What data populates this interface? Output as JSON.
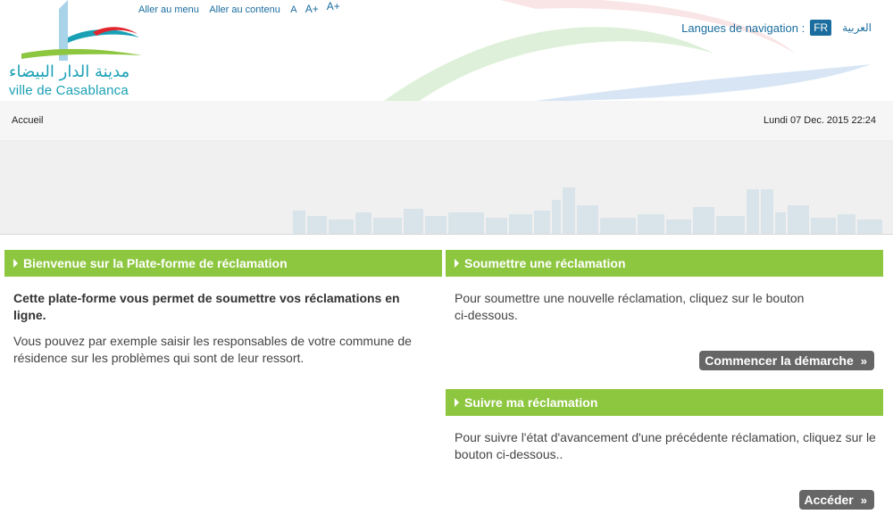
{
  "header": {
    "logo_arabic": "مدينة الدار البيضاء",
    "logo_french": "ville de Casablanca",
    "access_links": {
      "menu": "Aller au menu",
      "content": "Aller au contenu",
      "font_small": "A",
      "font_medium": "A+",
      "font_large": "A+"
    },
    "language": {
      "label": "Langues de navigation :",
      "current": "FR",
      "arabic": "العربية"
    }
  },
  "breadcrumb": {
    "home": "Accueil",
    "datetime": "Lundi 07 Dec. 2015 22:24"
  },
  "welcome": {
    "title": "Bienvenue sur la Plate-forme de réclamation",
    "intro": "Cette plate-forme vous permet de soumettre vos réclamations en ligne.",
    "body": "Vous pouvez par exemple saisir les responsables de votre commune de résidence sur les problèmes qui sont de leur ressort."
  },
  "submit": {
    "title": "Soumettre une réclamation",
    "body": "Pour soumettre une nouvelle réclamation, cliquez sur le bouton ci-dessous.",
    "button": "Commencer la démarche",
    "chevron": "»"
  },
  "track": {
    "title": "Suivre ma réclamation",
    "body": "Pour suivre l'état d'avancement d'une précédente réclamation, cliquez sur le bouton ci-dessous..",
    "button": "Accéder",
    "chevron": "»"
  },
  "colors": {
    "accent_green": "#8dc63f",
    "link_blue": "#1a6d9e",
    "button_gray": "#666666"
  }
}
